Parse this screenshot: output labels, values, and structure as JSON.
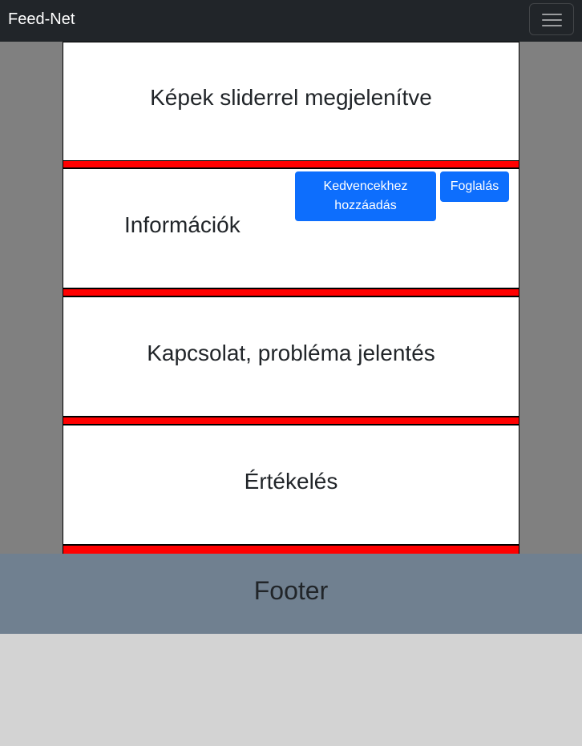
{
  "navbar": {
    "brand": "Feed-Net",
    "toggler_icon": "hamburger-menu-icon"
  },
  "sections": {
    "slider": {
      "title": "Képek sliderrel megjelenítve"
    },
    "info": {
      "title": "Információk",
      "favorite_button": "Kedvencekhez hozzáadás",
      "booking_button": "Foglalás"
    },
    "contact": {
      "title": "Kapcsolat, probléma jelentés"
    },
    "rating": {
      "title": "Értékelés"
    }
  },
  "footer": {
    "text": "Footer"
  },
  "colors": {
    "navbar": "#212529",
    "main_background": "#808080",
    "separator": "#ff0000",
    "button": "#0d6efd",
    "footer": "#708090",
    "page_background": "#d3d3d3"
  }
}
